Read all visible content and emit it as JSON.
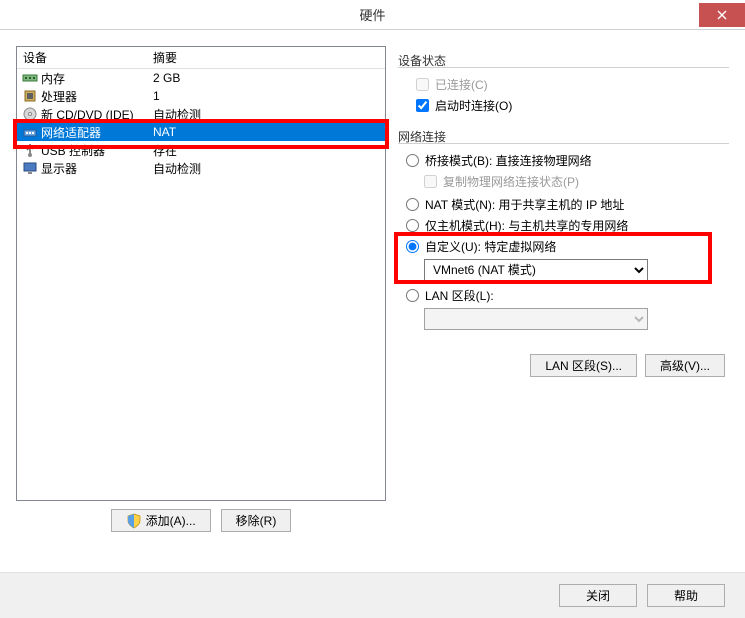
{
  "window": {
    "title": "硬件"
  },
  "columns": {
    "device": "设备",
    "summary": "摘要"
  },
  "devices": [
    {
      "name": "内存",
      "summary": "2 GB",
      "icon": "memory"
    },
    {
      "name": "处理器",
      "summary": "1",
      "icon": "cpu"
    },
    {
      "name": "新 CD/DVD (IDE)",
      "summary": "自动检测",
      "icon": "cd"
    },
    {
      "name": "网络适配器",
      "summary": "NAT",
      "icon": "network",
      "selected": true
    },
    {
      "name": "USB 控制器",
      "summary": "存在",
      "icon": "usb"
    },
    {
      "name": "显示器",
      "summary": "自动检测",
      "icon": "display"
    }
  ],
  "buttons": {
    "add": "添加(A)...",
    "remove": "移除(R)",
    "lan_segments": "LAN 区段(S)...",
    "advanced": "高级(V)...",
    "close": "关闭",
    "help": "帮助"
  },
  "device_status": {
    "title": "设备状态",
    "connected": "已连接(C)",
    "connect_at_power": "启动时连接(O)"
  },
  "network_connection": {
    "title": "网络连接",
    "bridged": "桥接模式(B): 直接连接物理网络",
    "replicate": "复制物理网络连接状态(P)",
    "nat": "NAT 模式(N): 用于共享主机的 IP 地址",
    "host_only": "仅主机模式(H): 与主机共享的专用网络",
    "custom": "自定义(U): 特定虚拟网络",
    "custom_value": "VMnet6 (NAT 模式)",
    "lan_segment": "LAN 区段(L):",
    "lan_segment_value": ""
  }
}
